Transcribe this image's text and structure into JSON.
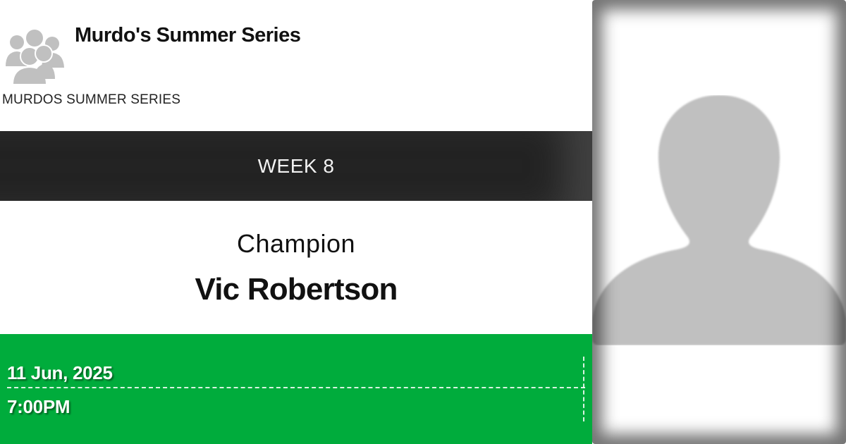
{
  "header": {
    "title": "Murdo's Summer Series",
    "subtitle": "MURDOS SUMMER SERIES",
    "icon": "group-users-icon"
  },
  "week": {
    "label": "WEEK 8"
  },
  "champion": {
    "label": "Champion",
    "name": "Vic Robertson"
  },
  "schedule": {
    "date": "11 Jun, 2025",
    "time": "7:00PM"
  },
  "photo": {
    "icon": "person-silhouette-icon"
  },
  "colors": {
    "week_band": "#232323",
    "date_band": "#00ac3c",
    "icon_gray": "#c0c0c0"
  }
}
